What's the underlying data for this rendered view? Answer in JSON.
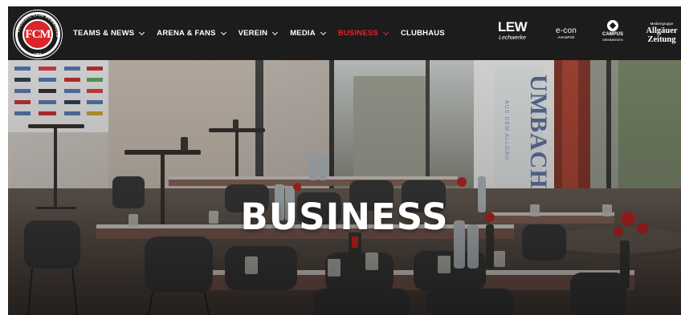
{
  "nav": {
    "logo_text": "FCM",
    "logo_ring_text": "FUSSBALL-CLUB MEMMINGEN",
    "logo_year": "1907",
    "items": [
      {
        "label": "TEAMS & NEWS",
        "has_dropdown": true,
        "active": false
      },
      {
        "label": "ARENA & FANS",
        "has_dropdown": true,
        "active": false
      },
      {
        "label": "VEREIN",
        "has_dropdown": true,
        "active": false
      },
      {
        "label": "MEDIA",
        "has_dropdown": true,
        "active": false
      },
      {
        "label": "BUSINESS",
        "has_dropdown": true,
        "active": true
      },
      {
        "label": "CLUBHAUS",
        "has_dropdown": false,
        "active": false
      }
    ],
    "active_color": "#e8202a",
    "background": "#1c1c1c"
  },
  "sponsors": {
    "lew": {
      "name": "LEW",
      "sub": "Lechwerke"
    },
    "econ": {
      "name": "e-con",
      "sub": "ArenaPark"
    },
    "campus": {
      "name": "CAMPUS",
      "sub": "MEMMINGEN"
    },
    "allgaeuer": {
      "super": "Mediengruppe",
      "name_1": "Allgäuer",
      "name_2": "Zeitung"
    }
  },
  "hero": {
    "title": "BUSINESS",
    "banner_text": "UMBACH",
    "banner_sub": "AUS DEM ALLGÄU"
  }
}
